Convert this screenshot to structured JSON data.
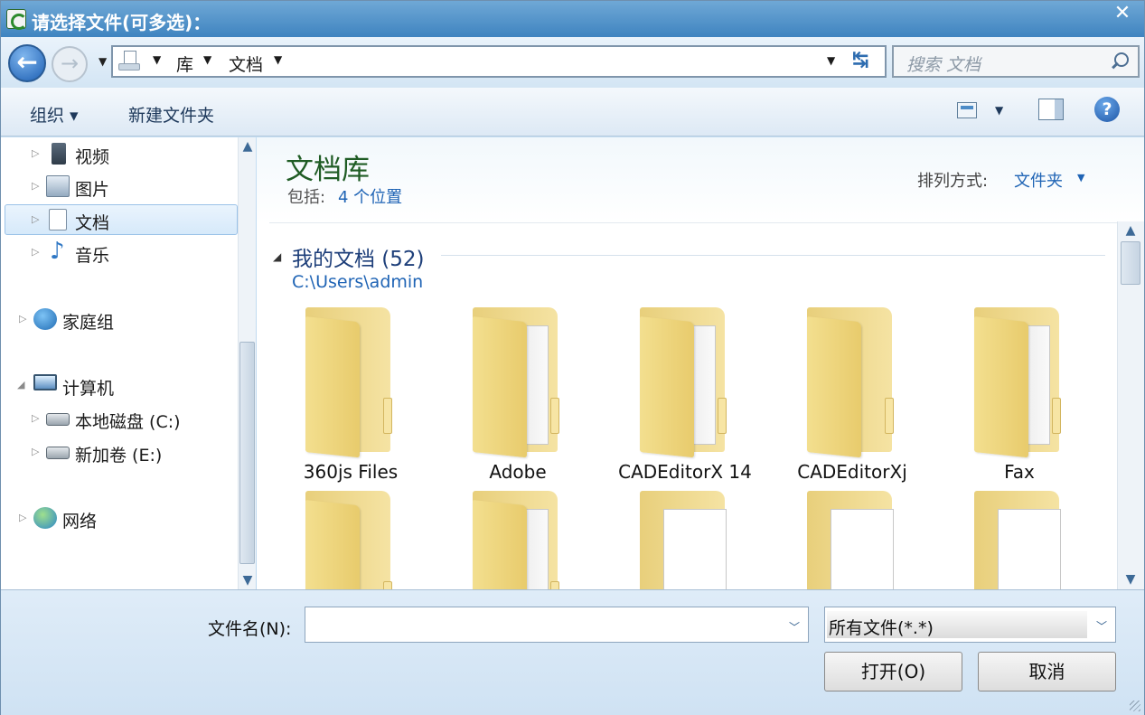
{
  "window": {
    "title": "请选择文件(可多选)：",
    "close": "✕"
  },
  "nav": {
    "breadcrumbs": [
      "库",
      "文档"
    ],
    "search_placeholder": "搜索 文档"
  },
  "toolbar": {
    "organize": "组织 ▾",
    "new_folder": "新建文件夹"
  },
  "sidebar": {
    "items": [
      {
        "label": "视频",
        "icon": "video-icon"
      },
      {
        "label": "图片",
        "icon": "pictures-icon"
      },
      {
        "label": "文档",
        "icon": "documents-icon",
        "selected": true
      },
      {
        "label": "音乐",
        "icon": "music-icon"
      },
      {
        "label": "家庭组",
        "icon": "homegroup-icon"
      },
      {
        "label": "计算机",
        "icon": "computer-icon"
      },
      {
        "label": "本地磁盘 (C:)",
        "icon": "drive-icon"
      },
      {
        "label": "新加卷 (E:)",
        "icon": "drive-icon"
      },
      {
        "label": "网络",
        "icon": "network-icon"
      }
    ]
  },
  "library": {
    "title": "文档库",
    "includes_label": "包括:",
    "includes_link": "4 个位置",
    "arrange_label": "排列方式:",
    "arrange_value": "文件夹",
    "group_title": "我的文档 (52)",
    "group_path": "C:\\Users\\admin",
    "folders": [
      "360js Files",
      "Adobe",
      "CADEditorX 14",
      "CADEditorXj",
      "Fax"
    ]
  },
  "footer": {
    "filename_label": "文件名(N):",
    "filename_value": "",
    "filter_value": "所有文件(*.*)",
    "open_label": "打开(O)",
    "cancel_label": "取消"
  },
  "colors": {
    "title_bar": "#3f84c0",
    "library_title": "#1f5c24",
    "link": "#1f64b5"
  }
}
